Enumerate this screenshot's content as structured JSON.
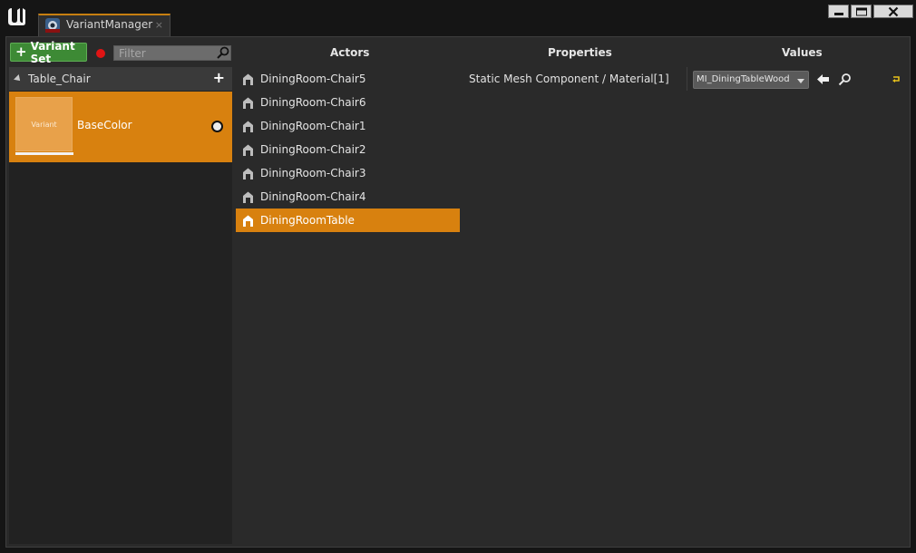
{
  "window": {
    "tab_title": "VariantManager",
    "tab_close": "×"
  },
  "toolbar": {
    "add_variant_set_label": "Variant Set",
    "add_variant_set_icon": "plus-icon",
    "record_color": "#e01414",
    "filter_placeholder": "Filter"
  },
  "variant_sets": [
    {
      "name": "Table_Chair",
      "variants": [
        {
          "name": "BaseColor",
          "thumbnail_text": "Variant",
          "active": true
        }
      ]
    }
  ],
  "columns": {
    "actors": "Actors",
    "properties": "Properties",
    "values": "Values"
  },
  "actors": [
    {
      "name": "DiningRoom-Chair5",
      "selected": false
    },
    {
      "name": "DiningRoom-Chair6",
      "selected": false
    },
    {
      "name": "DiningRoom-Chair1",
      "selected": false
    },
    {
      "name": "DiningRoom-Chair2",
      "selected": false
    },
    {
      "name": "DiningRoom-Chair3",
      "selected": false
    },
    {
      "name": "DiningRoom-Chair4",
      "selected": false
    },
    {
      "name": "DiningRoomTable",
      "selected": true
    }
  ],
  "properties": [
    {
      "label": "Static Mesh Component / Material[1]",
      "value": "MI_DiningTableWood"
    }
  ],
  "colors": {
    "accent": "#d8810f",
    "add_button": "#3d8a35",
    "background": "#2a2a2a"
  }
}
